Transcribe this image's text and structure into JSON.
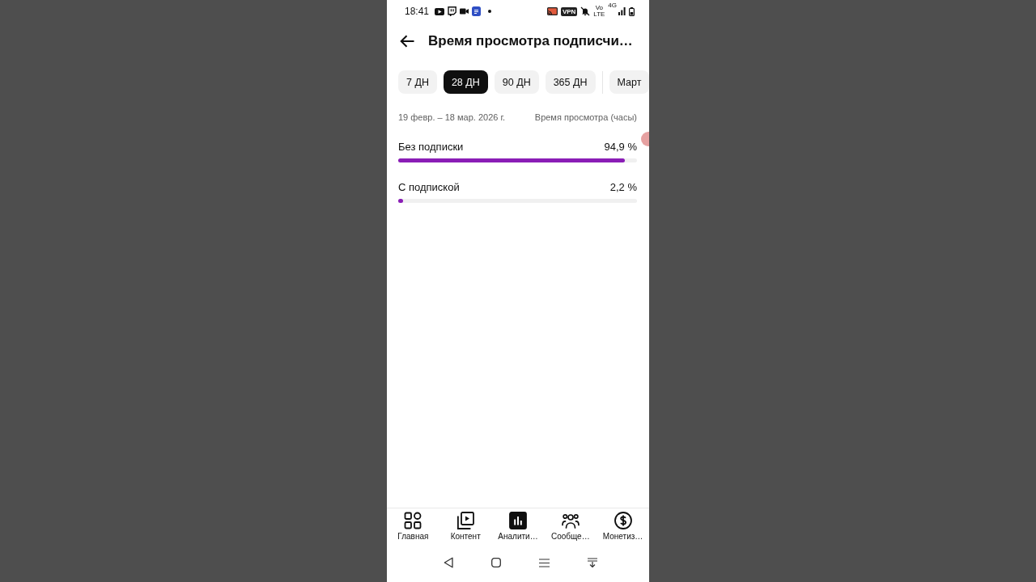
{
  "status_bar": {
    "time": "18:41",
    "vpn": "VPN",
    "volte": "Vo LTE",
    "network": "4G"
  },
  "header": {
    "title": "Время просмотра подписчи…"
  },
  "period_chips": [
    {
      "label": "7 ДН",
      "selected": false
    },
    {
      "label": "28 ДН",
      "selected": true
    },
    {
      "label": "90 ДН",
      "selected": false
    },
    {
      "label": "365 ДН",
      "selected": false
    }
  ],
  "month_chips": [
    {
      "label": "Март",
      "selected": false
    }
  ],
  "summary": {
    "date_range": "19 февр. – 18 мар. 2026 г.",
    "metric": "Время просмотра (часы)"
  },
  "rows": [
    {
      "label": "Без подписки",
      "value": "94,9 %",
      "level": 0.949
    },
    {
      "label": "С подпиской",
      "value": "2,2 %",
      "level": 0.022
    }
  ],
  "bottom_nav": [
    {
      "label": "Главная",
      "selected": false
    },
    {
      "label": "Контент",
      "selected": false
    },
    {
      "label": "Аналити…",
      "selected": true
    },
    {
      "label": "Сообще…",
      "selected": false
    },
    {
      "label": "Монетиз…",
      "selected": false
    }
  ]
}
